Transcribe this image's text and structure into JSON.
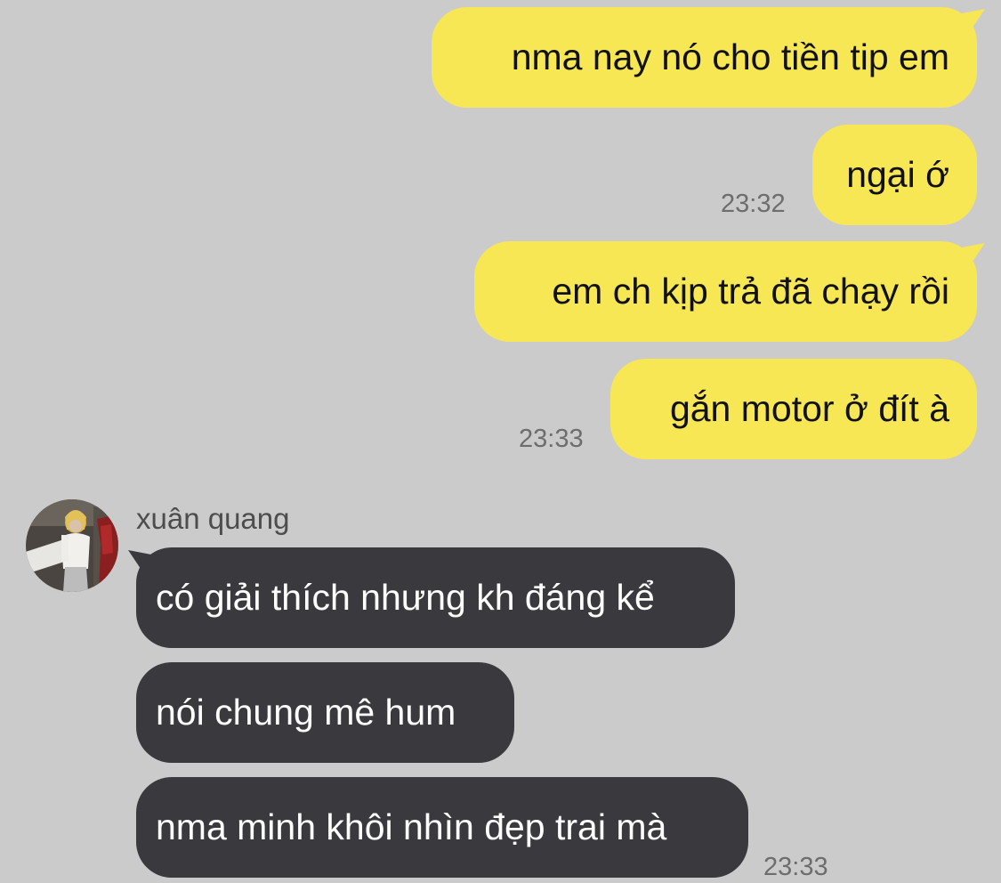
{
  "messages_out": [
    {
      "text": "nma nay nó cho tiền tip em",
      "time": ""
    },
    {
      "text": "ngại ớ",
      "time": "23:32"
    },
    {
      "text": "em ch kịp trả đã chạy rồi",
      "time": ""
    },
    {
      "text": "gắn motor ở đít à",
      "time": "23:33"
    }
  ],
  "incoming": {
    "sender_name": "xuân quang",
    "avatar_icon": "profile-photo",
    "messages": [
      {
        "text": "có giải thích nhưng kh đáng kể",
        "time": ""
      },
      {
        "text": "nói chung mê hum",
        "time": ""
      },
      {
        "text": "nma minh khôi nhìn đẹp trai mà",
        "time": "23:33"
      }
    ]
  },
  "colors": {
    "background": "#cbcbcb",
    "outgoing_bubble": "#f7e755",
    "incoming_bubble": "#3a393e",
    "timestamp": "#6d6d6d"
  }
}
